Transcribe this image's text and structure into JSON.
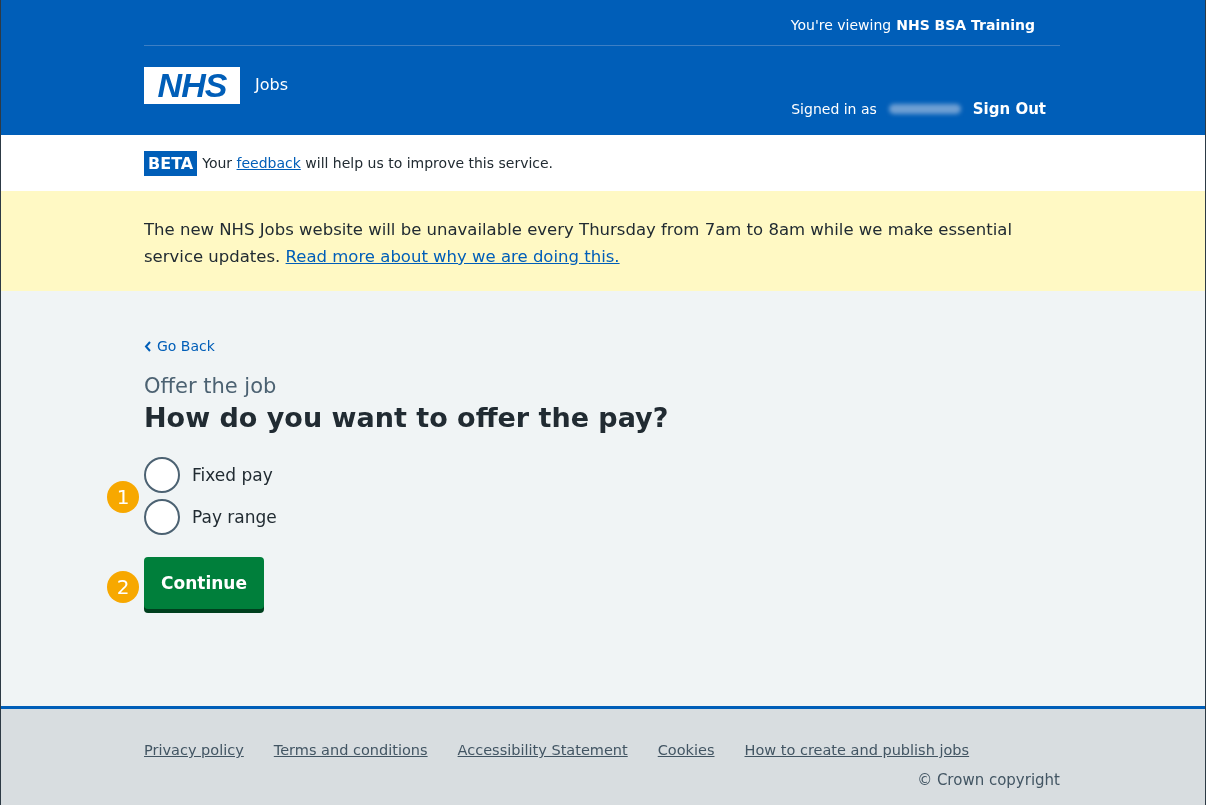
{
  "header": {
    "viewing_prefix": "You're viewing",
    "viewing_org": "NHS BSA Training",
    "logo": "NHS",
    "service": "Jobs",
    "signed_in": "Signed in as",
    "sign_out": "Sign Out"
  },
  "beta": {
    "tag": "BETA",
    "before": "Your",
    "link": "feedback",
    "after": "will help us to improve this service."
  },
  "notice": {
    "text": "The new NHS Jobs website will be unavailable every Thursday from 7am to 8am while we make essential service updates.",
    "link": "Read more about why we are doing this."
  },
  "back": "Go Back",
  "caption": "Offer the job",
  "heading": "How do you want to offer the pay?",
  "options": [
    {
      "label": "Fixed pay",
      "selected": false
    },
    {
      "label": "Pay range",
      "selected": false
    }
  ],
  "callouts": [
    "1",
    "2"
  ],
  "button": "Continue",
  "footer": {
    "links": [
      "Privacy policy",
      "Terms and conditions",
      "Accessibility Statement",
      "Cookies",
      "How to create and publish jobs"
    ],
    "copyright": "© Crown copyright"
  }
}
